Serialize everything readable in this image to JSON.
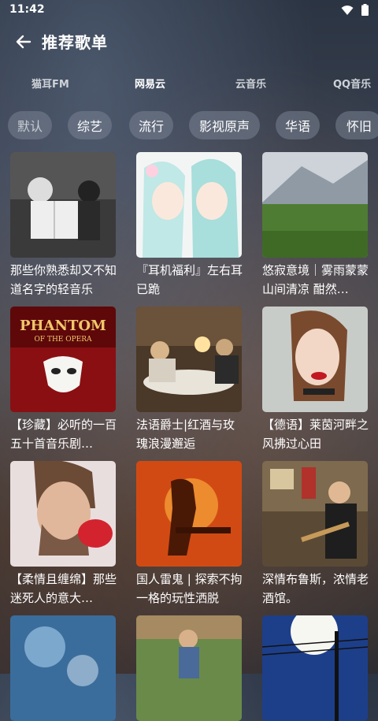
{
  "status_bar": {
    "time": "11:42"
  },
  "app_bar": {
    "title": "推荐歌单"
  },
  "source_tabs": [
    {
      "label": "猫耳FM",
      "active": false
    },
    {
      "label": "网易云",
      "active": true
    },
    {
      "label": "云音乐",
      "active": false
    },
    {
      "label": "QQ音乐",
      "active": false
    }
  ],
  "categories": [
    {
      "label": "默认",
      "selected": true
    },
    {
      "label": "综艺",
      "selected": false
    },
    {
      "label": "流行",
      "selected": false
    },
    {
      "label": "影视原声",
      "selected": false
    },
    {
      "label": "华语",
      "selected": false
    },
    {
      "label": "怀旧",
      "selected": false
    }
  ],
  "playlists": [
    {
      "title": "那些你熟悉却又不知道名字的轻音乐"
    },
    {
      "title": "『耳机福利』左右耳已跪"
    },
    {
      "title": "悠寂意境｜雾雨蒙蒙 山间清凉 酣然…"
    },
    {
      "title": "【珍藏】必听的一百五十首音乐剧…",
      "cover_text": "PHANTOM",
      "cover_subtext": "OF THE OPERA"
    },
    {
      "title": "法语爵士|红酒与玫瑰浪漫邂逅"
    },
    {
      "title": "【德语】莱茵河畔之风拂过心田"
    },
    {
      "title": "【柔情且缠绵】那些迷死人的意大…"
    },
    {
      "title": "国人雷鬼 | 探索不拘一格的玩性洒脱"
    },
    {
      "title": "深情布鲁斯，浓情老酒馆。"
    },
    {
      "title": ""
    },
    {
      "title": ""
    },
    {
      "title": ""
    }
  ]
}
